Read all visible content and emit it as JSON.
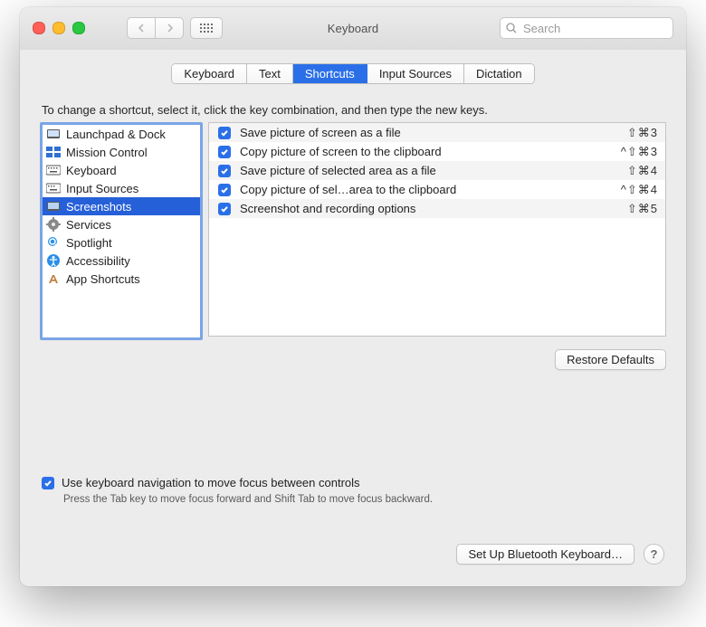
{
  "window": {
    "title": "Keyboard",
    "search_placeholder": "Search"
  },
  "tabs": [
    {
      "label": "Keyboard",
      "selected": false
    },
    {
      "label": "Text",
      "selected": false
    },
    {
      "label": "Shortcuts",
      "selected": true
    },
    {
      "label": "Input Sources",
      "selected": false
    },
    {
      "label": "Dictation",
      "selected": false
    }
  ],
  "instruction": "To change a shortcut, select it, click the key combination, and then type the new keys.",
  "categories": [
    {
      "label": "Launchpad & Dock",
      "icon": "launchpad-icon",
      "selected": false
    },
    {
      "label": "Mission Control",
      "icon": "mission-control-icon",
      "selected": false
    },
    {
      "label": "Keyboard",
      "icon": "keyboard-icon",
      "selected": false
    },
    {
      "label": "Input Sources",
      "icon": "input-sources-icon",
      "selected": false
    },
    {
      "label": "Screenshots",
      "icon": "screenshots-icon",
      "selected": true
    },
    {
      "label": "Services",
      "icon": "services-icon",
      "selected": false
    },
    {
      "label": "Spotlight",
      "icon": "spotlight-icon",
      "selected": false
    },
    {
      "label": "Accessibility",
      "icon": "accessibility-icon",
      "selected": false
    },
    {
      "label": "App Shortcuts",
      "icon": "app-shortcuts-icon",
      "selected": false
    }
  ],
  "shortcuts": [
    {
      "checked": true,
      "label": "Save picture of screen as a file",
      "keys": "⇧⌘3"
    },
    {
      "checked": true,
      "label": "Copy picture of screen to the clipboard",
      "keys": "^⇧⌘3"
    },
    {
      "checked": true,
      "label": "Save picture of selected area as a file",
      "keys": "⇧⌘4"
    },
    {
      "checked": true,
      "label": "Copy picture of sel…area to the clipboard",
      "keys": "^⇧⌘4"
    },
    {
      "checked": true,
      "label": "Screenshot and recording options",
      "keys": "⇧⌘5"
    }
  ],
  "restore_label": "Restore Defaults",
  "kbdnav": {
    "checked": true,
    "label": "Use keyboard navigation to move focus between controls",
    "desc": "Press the Tab key to move focus forward and Shift Tab to move focus backward."
  },
  "bluetooth_label": "Set Up Bluetooth Keyboard…"
}
